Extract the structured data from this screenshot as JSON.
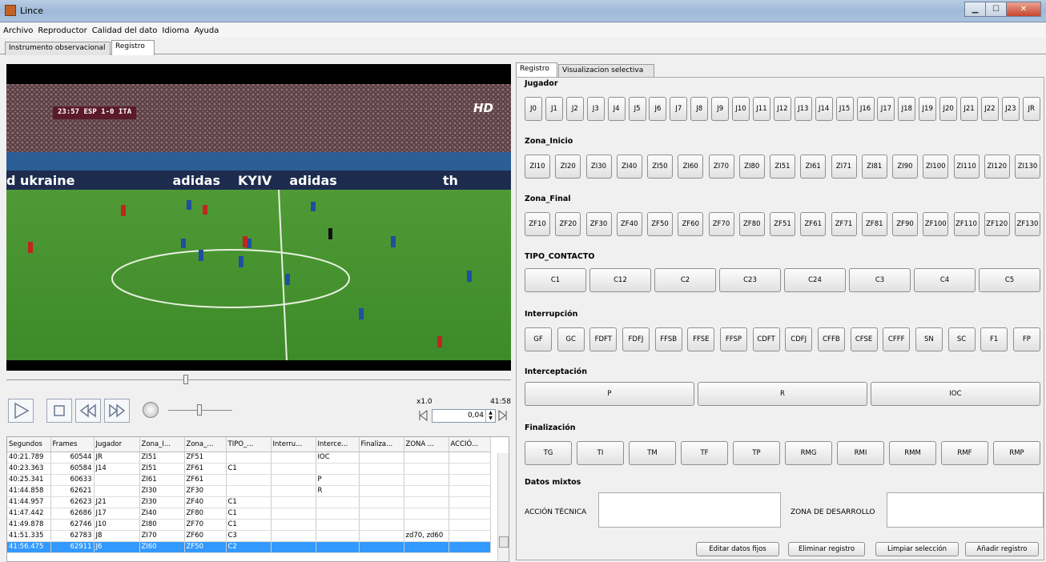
{
  "window": {
    "title": "Lince"
  },
  "menu": [
    "Archivo",
    "Reproductor",
    "Calidad del dato",
    "Idioma",
    "Ayuda"
  ],
  "outer_tabs": [
    "Instrumento observacional",
    "Registro"
  ],
  "video": {
    "score": "23:57  ESP 1-0 ITA",
    "channel": "HD",
    "billboard": [
      "d ukraine",
      "adidas",
      "KYIV",
      "adidas",
      "th"
    ]
  },
  "player": {
    "speed": "x1.0",
    "duration": "41:58",
    "step": "0,04"
  },
  "table": {
    "columns": [
      "Segundos",
      "Frames",
      "Jugador",
      "Zona_I...",
      "Zona_...",
      "TIPO_...",
      "Interru...",
      "Interce...",
      "Finaliza...",
      "ZONA ...",
      "ACCIÓ..."
    ],
    "rows": [
      [
        "40:21.789",
        "60544",
        "JR",
        "ZI51",
        "ZF51",
        "",
        "",
        "IOC",
        "",
        "",
        ""
      ],
      [
        "40:23.363",
        "60584",
        "J14",
        "ZI51",
        "ZF61",
        "C1",
        "",
        "",
        "",
        "",
        ""
      ],
      [
        "40:25.341",
        "60633",
        "",
        "ZI61",
        "ZF61",
        "",
        "",
        "P",
        "",
        "",
        ""
      ],
      [
        "41:44.858",
        "62621",
        "",
        "ZI30",
        "ZF30",
        "",
        "",
        "R",
        "",
        "",
        ""
      ],
      [
        "41:44.957",
        "62623",
        "J21",
        "ZI30",
        "ZF40",
        "C1",
        "",
        "",
        "",
        "",
        ""
      ],
      [
        "41:47.442",
        "62686",
        "J17",
        "ZI40",
        "ZF80",
        "C1",
        "",
        "",
        "",
        "",
        ""
      ],
      [
        "41:49.878",
        "62746",
        "J10",
        "ZI80",
        "ZF70",
        "C1",
        "",
        "",
        "",
        "",
        ""
      ],
      [
        "41:51.335",
        "62783",
        "J8",
        "ZI70",
        "ZF60",
        "C3",
        "",
        "",
        "",
        "zd70, zd60",
        ""
      ],
      [
        "41:56.475",
        "62911",
        "J6",
        "ZI60",
        "ZF50",
        "C2",
        "",
        "",
        "",
        "",
        ""
      ]
    ],
    "selected_row": 8
  },
  "right_tabs": [
    "Registro",
    "Visualizacion selectiva"
  ],
  "sections": [
    {
      "label": "Jugador",
      "buttons": [
        "J0",
        "J1",
        "J2",
        "J3",
        "J4",
        "J5",
        "J6",
        "J7",
        "J8",
        "J9",
        "J10",
        "J11",
        "J12",
        "J13",
        "J14",
        "J15",
        "J16",
        "J17",
        "J18",
        "J19",
        "J20",
        "J21",
        "J22",
        "J23",
        "JR"
      ]
    },
    {
      "label": "Zona_Inicio",
      "buttons": [
        "ZI10",
        "ZI20",
        "ZI30",
        "ZI40",
        "ZI50",
        "ZI60",
        "ZI70",
        "ZI80",
        "ZI51",
        "ZI61",
        "ZI71",
        "ZI81",
        "ZI90",
        "ZI100",
        "ZI110",
        "ZI120",
        "ZI130"
      ]
    },
    {
      "label": "Zona_Final",
      "buttons": [
        "ZF10",
        "ZF20",
        "ZF30",
        "ZF40",
        "ZF50",
        "ZF60",
        "ZF70",
        "ZF80",
        "ZF51",
        "ZF61",
        "ZF71",
        "ZF81",
        "ZF90",
        "ZF100",
        "ZF110",
        "ZF120",
        "ZF130"
      ]
    },
    {
      "label": "TIPO_CONTACTO",
      "buttons": [
        "C1",
        "C12",
        "C2",
        "C23",
        "C24",
        "C3",
        "C4",
        "C5"
      ]
    },
    {
      "label": "Interrupción",
      "buttons": [
        "GF",
        "GC",
        "FDFT",
        "FDFJ",
        "FFSB",
        "FFSE",
        "FFSP",
        "CDFT",
        "CDFJ",
        "CFFB",
        "CFSE",
        "CFFF",
        "SN",
        "SC",
        "F1",
        "FP"
      ]
    },
    {
      "label": "Interceptación",
      "buttons": [
        "P",
        "R",
        "IOC"
      ]
    },
    {
      "label": "Finalización",
      "buttons": [
        "TG",
        "TI",
        "TM",
        "TF",
        "TP",
        "RMG",
        "RMI",
        "RMM",
        "RMF",
        "RMP"
      ]
    }
  ],
  "mixed": {
    "label": "Datos mixtos",
    "field1": "ACCIÓN TÉCNICA",
    "field2": "ZONA DE DESARROLLO"
  },
  "actions": [
    "Editar datos fijos",
    "Eliminar registro",
    "Limpiar selección",
    "Añadir registro"
  ]
}
